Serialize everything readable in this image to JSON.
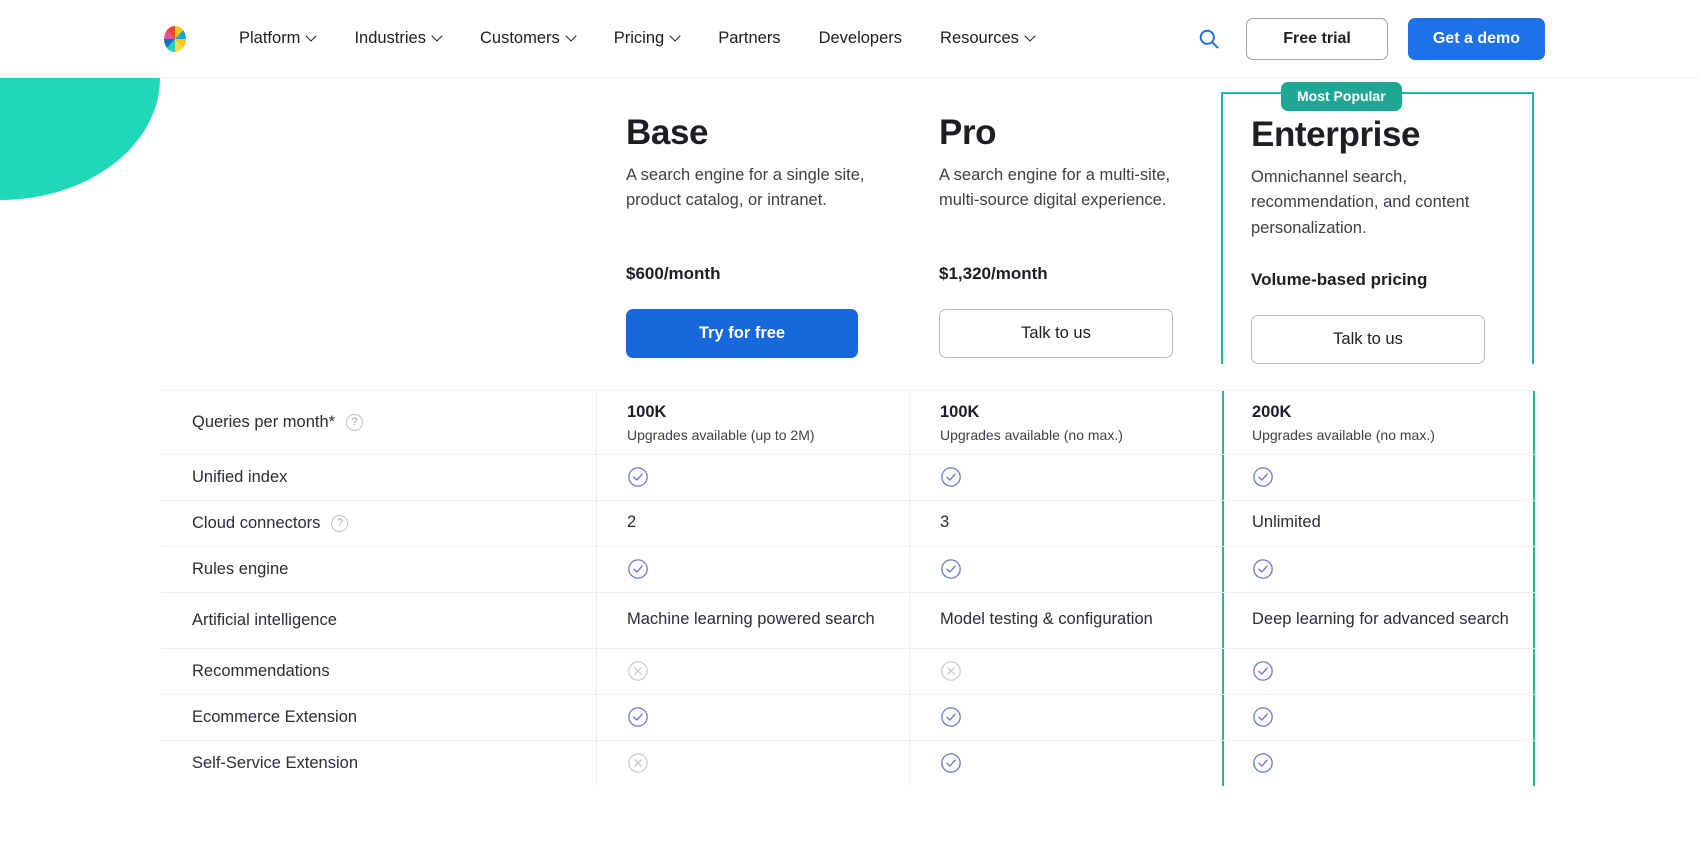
{
  "nav": {
    "logo_name": "elastic-logo",
    "links": [
      {
        "label": "Platform",
        "has_menu": true
      },
      {
        "label": "Industries",
        "has_menu": true
      },
      {
        "label": "Customers",
        "has_menu": true
      },
      {
        "label": "Pricing",
        "has_menu": true
      },
      {
        "label": "Partners",
        "has_menu": false
      },
      {
        "label": "Developers",
        "has_menu": false
      },
      {
        "label": "Resources",
        "has_menu": true
      }
    ],
    "search_icon": "search-icon",
    "free_trial_label": "Free trial",
    "demo_label": "Get a demo",
    "accent_blue": "#1e72e8"
  },
  "decor": {
    "blob_color": "#1ed8b8"
  },
  "plans": [
    {
      "name": "Base",
      "description": "A search engine for a single site, product catalog, or intranet.",
      "price": "$600/month",
      "cta": "Try for free",
      "cta_style": "primary",
      "badge": null
    },
    {
      "name": "Pro",
      "description": "A search engine for a multi-site, multi-source digital experience.",
      "price": "$1,320/month",
      "cta": "Talk to us",
      "cta_style": "outline",
      "badge": null
    },
    {
      "name": "Enterprise",
      "description": "Omnichannel search, recommendation, and content personalization.",
      "price": "Volume-based pricing",
      "cta": "Talk to us",
      "cta_style": "outline",
      "badge": "Most Popular",
      "badge_color": "#1fa795",
      "highlight_color": "#26b4a0"
    }
  ],
  "features": [
    {
      "label": "Queries per month*",
      "has_help": true,
      "type": "text-sub",
      "values": [
        {
          "main": "100K",
          "sub": "Upgrades available (up to 2M)"
        },
        {
          "main": "100K",
          "sub": "Upgrades available (no max.)"
        },
        {
          "main": "200K",
          "sub": "Upgrades available (no max.)"
        }
      ]
    },
    {
      "label": "Unified index",
      "has_help": false,
      "type": "icon",
      "values": [
        {
          "icon": "check-circle-icon"
        },
        {
          "icon": "check-circle-icon"
        },
        {
          "icon": "check-circle-icon"
        }
      ]
    },
    {
      "label": "Cloud connectors",
      "has_help": true,
      "type": "text",
      "values": [
        {
          "main": "2"
        },
        {
          "main": "3"
        },
        {
          "main": "Unlimited"
        }
      ]
    },
    {
      "label": "Rules engine",
      "has_help": false,
      "type": "icon",
      "values": [
        {
          "icon": "check-circle-icon"
        },
        {
          "icon": "check-circle-icon"
        },
        {
          "icon": "check-circle-icon"
        }
      ]
    },
    {
      "label": "Artificial intelligence",
      "has_help": false,
      "type": "text",
      "values": [
        {
          "main": "Machine learning powered search"
        },
        {
          "main": "Model testing & configuration"
        },
        {
          "main": "Deep learning for advanced search"
        }
      ]
    },
    {
      "label": "Recommendations",
      "has_help": false,
      "type": "icon",
      "values": [
        {
          "icon": "x-circle-icon"
        },
        {
          "icon": "x-circle-icon"
        },
        {
          "icon": "check-circle-icon"
        }
      ]
    },
    {
      "label": "Ecommerce Extension",
      "has_help": false,
      "type": "icon",
      "values": [
        {
          "icon": "check-circle-icon"
        },
        {
          "icon": "check-circle-icon"
        },
        {
          "icon": "check-circle-icon"
        }
      ]
    },
    {
      "label": "Self-Service Extension",
      "has_help": false,
      "type": "icon",
      "values": [
        {
          "icon": "x-circle-icon"
        },
        {
          "icon": "check-circle-icon"
        },
        {
          "icon": "check-circle-icon"
        }
      ]
    }
  ],
  "icons": {
    "help_glyph": "?",
    "check_color": "#6d79c4",
    "x_color": "#c9ccd2"
  }
}
